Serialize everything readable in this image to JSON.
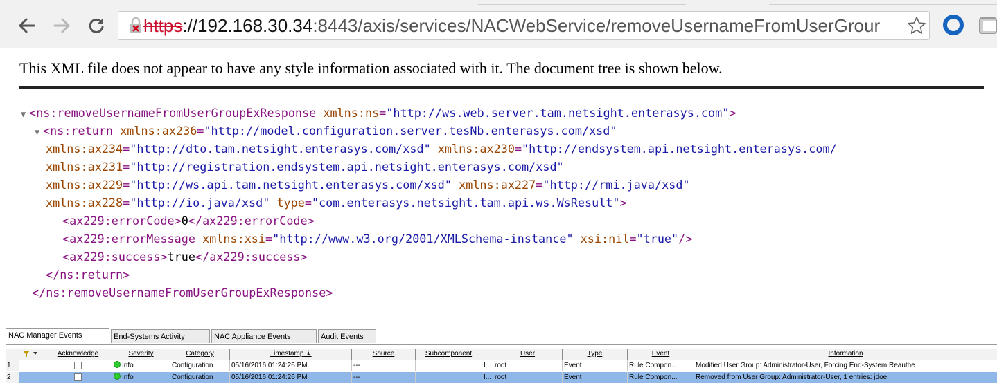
{
  "browser": {
    "url_scheme": "https",
    "url_host": "://192.168.30.34",
    "url_port": ":8443",
    "url_path": "/axis/services/NACWebService/removeUsernameFromUserGrour",
    "icons": [
      "back-icon",
      "forward-icon",
      "reload-icon",
      "insecure-lock-icon",
      "bookmark-star-icon",
      "extension-icon"
    ]
  },
  "xml_viewer": {
    "header": "This XML file does not appear to have any style information associated with it. The document tree is shown below.",
    "line1": {
      "tag": "<ns:removeUsernameFromUserGroupExResponse",
      "attr_name": "xmlns:ns",
      "attr_value": "\"http://ws.web.server.tam.netsight.enterasys.com\"",
      "close": ">"
    },
    "line2": {
      "tag": "<ns:return",
      "attr_name": "xmlns:ax236",
      "attr_value": "\"http://model.configuration.server.tesNb.enterasys.com/xsd\""
    },
    "line3": {
      "attr1_name": "xmlns:ax234",
      "attr1_value": "\"http://dto.tam.netsight.enterasys.com/xsd\"",
      "attr2_name": "xmlns:ax230",
      "attr2_value": "\"http://endsystem.api.netsight.enterasys.com/"
    },
    "line4": {
      "attr_name": "xmlns:ax231",
      "attr_value": "\"http://registration.endsystem.api.netsight.enterasys.com/xsd\""
    },
    "line5": {
      "attr1_name": "xmlns:ax229",
      "attr1_value": "\"http://ws.api.tam.netsight.enterasys.com/xsd\"",
      "attr2_name": "xmlns:ax227",
      "attr2_value": "\"http://rmi.java/xsd\""
    },
    "line6": {
      "attr1_name": "xmlns:ax228",
      "attr1_value": "\"http://io.java/xsd\"",
      "attr2_name": "type",
      "attr2_value": "\"com.enterasys.netsight.tam.api.ws.WsResult\"",
      "close": ">"
    },
    "line7": {
      "open": "<ax229:errorCode>",
      "text": "0",
      "close": "</ax229:errorCode>"
    },
    "line8": {
      "tag": "<ax229:errorMessage",
      "attr1_name": "xmlns:xsi",
      "attr1_value": "\"http://www.w3.org/2001/XMLSchema-instance\"",
      "attr2_name": "xsi:nil",
      "attr2_value": "\"true\"",
      "close": "/>"
    },
    "line9": {
      "open": "<ax229:success>",
      "text": "true",
      "close": "</ax229:success>"
    },
    "line10": {
      "tag": "</ns:return>"
    },
    "line11": {
      "tag": "</ns:removeUsernameFromUserGroupExResponse>"
    }
  },
  "events_panel": {
    "tabs": [
      "NAC Manager Events",
      "End-Systems Activity",
      "NAC Appliance Events",
      "Audit Events"
    ],
    "active_tab": "NAC Manager Events",
    "columns": [
      "Acknowledge",
      "Severity",
      "Category",
      "Timestamp",
      "Source",
      "Subcomponent",
      "User",
      "Type",
      "Event",
      "Information"
    ],
    "rows": [
      {
        "num": "1",
        "severity": "Info",
        "category": "Configuration",
        "timestamp": "05/16/2016 01:24:26 PM",
        "source": "---",
        "subcomponent_trunc": "I...",
        "user": "root",
        "type": "Event",
        "event": "Rule Compon...",
        "information": "Modified User Group: Administrator-User, Forcing End-System Reauthe"
      },
      {
        "num": "2",
        "severity": "Info",
        "category": "Configuration",
        "timestamp": "05/16/2016 01:24:26 PM",
        "source": "---",
        "subcomponent_trunc": "I...",
        "user": "root",
        "type": "Event",
        "event": "Rule Compon...",
        "information": "Removed from User Group: Administrator-User, 1 entries: jdoe"
      }
    ],
    "colors": {
      "selected_row": "#8fb8e9",
      "info_dot": "#2ecc2e"
    }
  }
}
